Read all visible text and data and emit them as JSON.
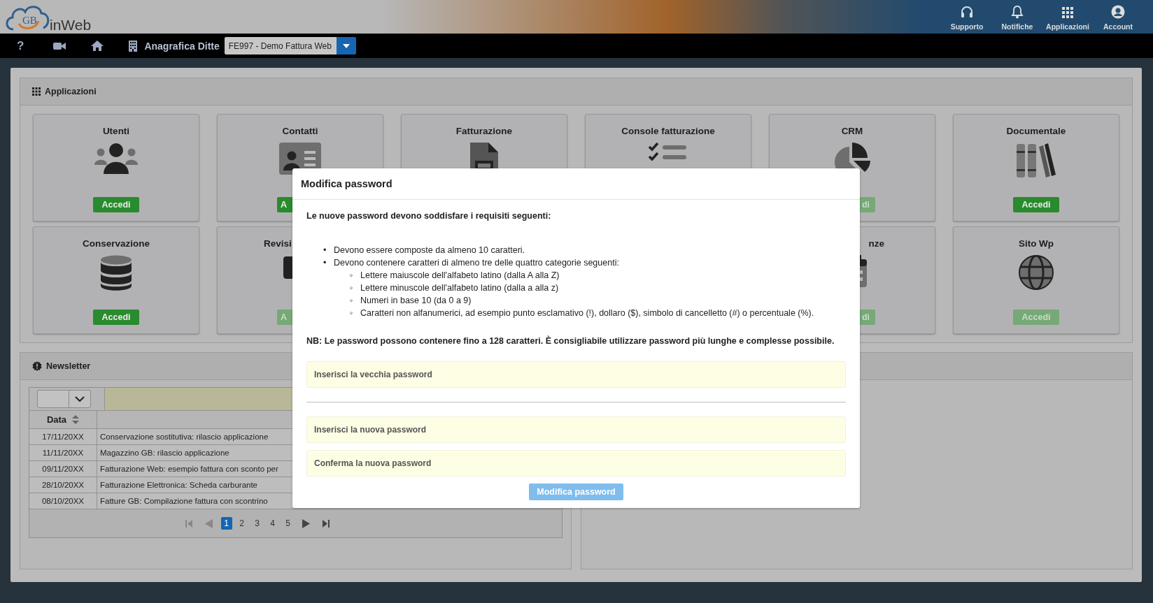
{
  "header": {
    "logo": {
      "mark": "GB",
      "name": "inWeb"
    },
    "nav": [
      {
        "label": "Supporto"
      },
      {
        "label": "Notifiche"
      },
      {
        "label": "Applicazioni"
      },
      {
        "label": "Account"
      }
    ]
  },
  "toolbar": {
    "help": "?",
    "company_label": "Anagrafica Ditte",
    "company_select": "FE997 - Demo Fattura Web"
  },
  "applications": {
    "title": "Applicazioni",
    "rows": [
      [
        {
          "label": "Utenti",
          "button": {
            "label": "Accedi",
            "disabled": false
          }
        },
        {
          "label": "Contatti",
          "button": {
            "label": "A",
            "disabled": false
          }
        },
        {
          "label": "Fatturazione"
        },
        {
          "label": "Console fatturazione"
        },
        {
          "label": "CRM",
          "button": {
            "label": "di",
            "disabled": true
          }
        },
        {
          "label": "Documentale",
          "button": {
            "label": "Accedi",
            "disabled": false
          }
        }
      ],
      [
        {
          "label": "Conservazione",
          "button": {
            "label": "Accedi",
            "disabled": false
          }
        },
        {
          "label": "Revisi",
          "button": {
            "label": "A",
            "disabled": true
          }
        },
        "",
        "",
        {
          "label": "nze",
          "button": {
            "label": "di",
            "disabled": true
          }
        },
        {
          "label": "Sito Wp",
          "button": {
            "label": "Accedi",
            "disabled": true
          }
        }
      ]
    ]
  },
  "newsletter": {
    "title": "Newsletter",
    "columns": [
      "Data"
    ],
    "rows": [
      {
        "date": "17/11/20XX",
        "title": "Conservazione sostitutiva: rilascio applicazione"
      },
      {
        "date": "11/11/20XX",
        "title": "Magazzino GB: rilascio applicazione"
      },
      {
        "date": "09/11/20XX",
        "title": "Fatturazione Web: esempio fattura con sconto per"
      },
      {
        "date": "28/10/20XX",
        "title": "Fatturazione Elettronica: Scheda carburante"
      },
      {
        "date": "08/10/20XX",
        "title": "Fatture GB: Compilazione fattura con scontrino"
      }
    ],
    "pages": [
      {
        "label": "1",
        "selected": true
      },
      {
        "label": "2",
        "selected": false
      },
      {
        "label": "3",
        "selected": false
      },
      {
        "label": "4",
        "selected": false
      },
      {
        "label": "5",
        "selected": false
      }
    ]
  },
  "modal": {
    "title": "Modifica password",
    "intro": "Le nuove password devono soddisfare i requisiti seguenti:",
    "requirements": [
      {
        "marker": "•",
        "text": "Devono essere composte da almeno 10 caratteri."
      },
      {
        "marker": "•",
        "text": "Devono contenere caratteri di almeno tre delle quattro categorie seguenti:",
        "children": [
          {
            "marker": "◦",
            "text": "Lettere maiuscole dell'alfabeto latino (dalla A alla Z)"
          },
          {
            "marker": "◦",
            "text": "Lettere minuscole dell'alfabeto latino (dalla a alla z)"
          },
          {
            "marker": "◦",
            "text": "Numeri in base 10 (da 0 a 9)"
          },
          {
            "marker": "◦",
            "text": "Caratteri non alfanumerici, ad esempio punto esclamativo (!), dollaro ($), simbolo di cancelletto (#) o percentuale (%)."
          }
        ]
      }
    ],
    "note": "NB: Le password possono contenere fino a 128 caratteri. È consigliabile utilizzare password più lunghe e complesse possibile.",
    "fields": [
      {
        "placeholder": "Inserisci la vecchia password"
      },
      {
        "placeholder": "Inserisci la nuova password"
      },
      {
        "placeholder": "Conferma la nuova password"
      }
    ],
    "button": {
      "label": "Modifica password",
      "disabled": true
    }
  }
}
